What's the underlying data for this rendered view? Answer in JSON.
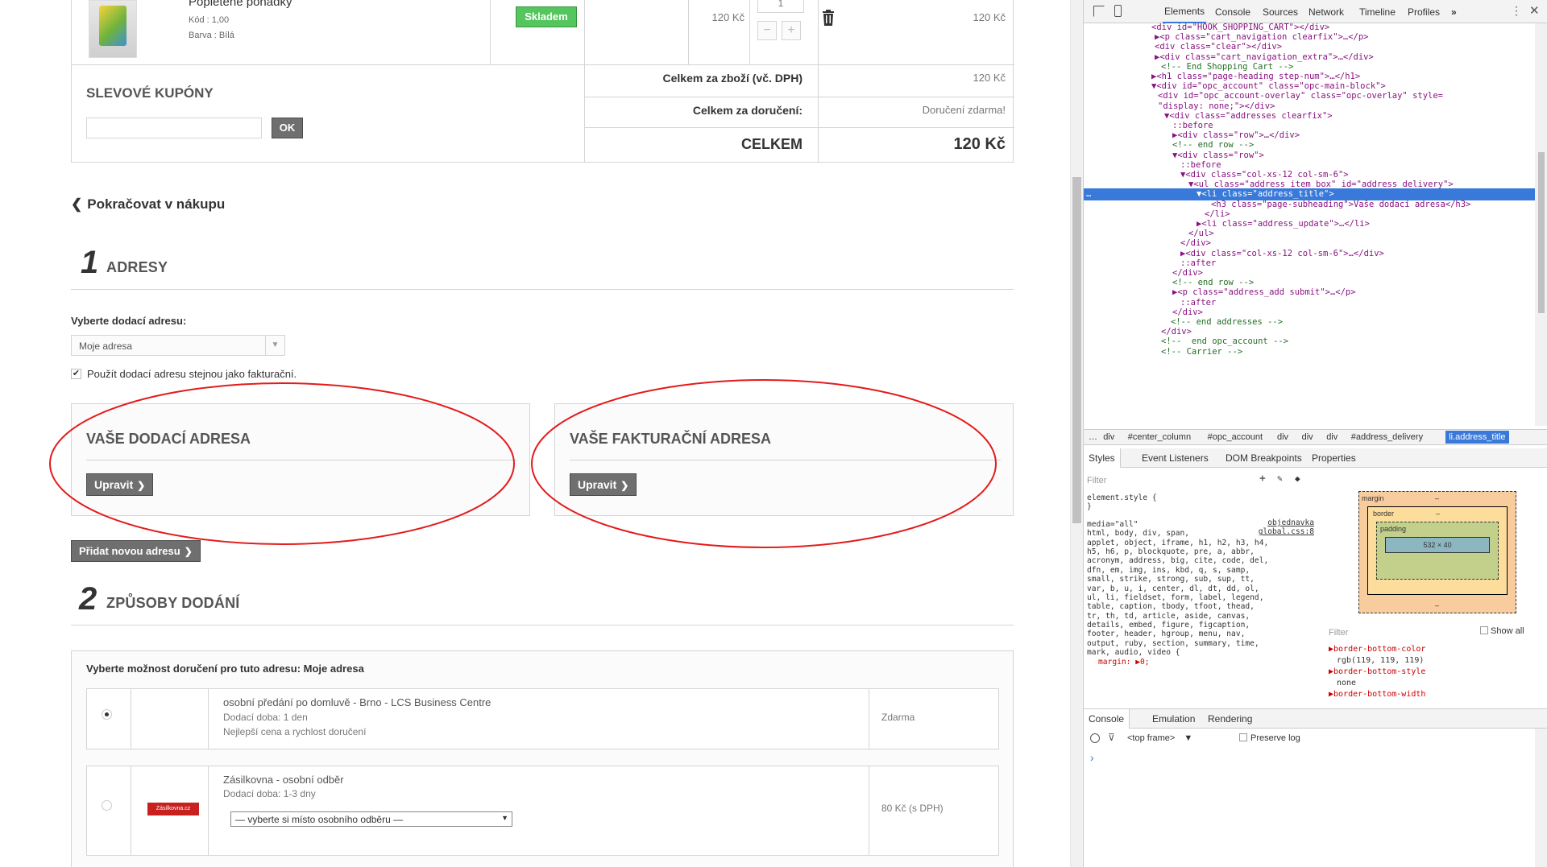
{
  "cart": {
    "product_name": "Popletené pohádky",
    "product_code": "Kód : 1,00",
    "product_color": "Barva : Bílá",
    "availability": "Skladem",
    "unit_price": "120 Kč",
    "quantity": "1",
    "line_total": "120 Kč",
    "minus": "−",
    "plus": "+"
  },
  "coupons": {
    "title": "SLEVOVÉ KUPÓNY",
    "input_value": "",
    "ok_label": "OK"
  },
  "summary": {
    "goods_label": "Celkem za zboží (vč. DPH)",
    "goods_value": "120 Kč",
    "delivery_label": "Celkem za doručení:",
    "delivery_value": "Doručení zdarma!",
    "total_label": "CELKEM",
    "total_value": "120 Kč"
  },
  "continue_shopping": "Pokračovat v nákupu",
  "step1": {
    "number": "1",
    "title": "ADRESY",
    "select_label": "Vyberte dodací adresu:",
    "select_value": "Moje adresa",
    "same_address_label": "Použít dodací adresu stejnou jako fakturační.",
    "same_address_checked": true,
    "delivery_title": "VAŠE DODACÍ ADRESA",
    "billing_title": "VAŠE FAKTURAČNÍ ADRESA",
    "edit_label": "Upravit",
    "add_new_label": "Přidat novou adresu"
  },
  "step2": {
    "number": "2",
    "title": "ZPŮSOBY DODÁNÍ",
    "choose_label": "Vyberte možnost doručení pro tuto adresu: Moje adresa",
    "options": [
      {
        "name": "osobní předání po domluvě - Brno - LCS Business Centre",
        "time": "Dodací doba: 1 den",
        "note": "Nejlepší cena a rychlost doručení",
        "price": "Zdarma",
        "selected": true
      },
      {
        "name": "Zásilkovna - osobní odběr",
        "time": "Dodací doba: 1-3 dny",
        "select_placeholder": "— vyberte si místo osobního odběru —",
        "logo_text": "Zásilkovna.cz",
        "price": "80 Kč (s DPH)",
        "selected": false
      }
    ]
  },
  "devtools": {
    "tabs": [
      "Elements",
      "Console",
      "Sources",
      "Network",
      "Timeline",
      "Profiles",
      "»"
    ],
    "dom_lines": [
      "<div id=\"HOOK_SHOPPING_CART\"></div>",
      "▶<p class=\"cart_navigation clearfix\">…</p>",
      "<div class=\"clear\"></div>",
      "▶<div class=\"cart_navigation_extra\">…</div>",
      "<!-- End Shopping Cart -->",
      "▶<h1 class=\"page-heading step-num\">…</h1>",
      "▼<div id=\"opc_account\" class=\"opc-main-block\">",
      "<div id=\"opc_account-overlay\" class=\"opc-overlay\" style=",
      "\"display: none;\"></div>",
      "▼<div class=\"addresses clearfix\">",
      "::before",
      "▶<div class=\"row\">…</div>",
      "<!-- end row -->",
      "▼<div class=\"row\">",
      "::before",
      "▼<div class=\"col-xs-12 col-sm-6\">",
      "▼<ul class=\"address item box\" id=\"address_delivery\">",
      "▼<li class=\"address_title\">",
      "<h3 class=\"page-subheading\">Vaše dodací adresa</h3>",
      "</li>",
      "▶<li class=\"address_update\">…</li>",
      "</ul>",
      "</div>",
      "▶<div class=\"col-xs-12 col-sm-6\">…</div>",
      "::after",
      "</div>",
      "<!-- end row -->",
      "▶<p class=\"address_add submit\">…</p>",
      "::after",
      "</div>",
      "<!-- end addresses -->",
      "</div>",
      "<!--  end opc_account -->",
      "<!-- Carrier -->"
    ],
    "breadcrumbs": [
      "…",
      "div",
      "#center_column",
      "#opc_account",
      "div",
      "div",
      "div",
      "#address_delivery",
      "li.address_title"
    ],
    "sub_tabs": [
      "Styles",
      "Event Listeners",
      "DOM Breakpoints",
      "Properties"
    ],
    "filter_placeholder": "Filter",
    "style_lines": [
      "element.style {",
      "}",
      "media=\"all\"",
      "html, body, div, span,",
      "applet, object, iframe, h1, h2, h3, h4,",
      "h5, h6, p, blockquote, pre, a, abbr,",
      "acronym, address, big, cite, code, del,",
      "dfn, em, img, ins, kbd, q, s, samp,",
      "small, strike, strong, sub, sup, tt,",
      "var, b, u, i, center, dl, dt, dd, ol,",
      "ul, li, fieldset, form, label, legend,",
      "table, caption, tbody, tfoot, thead,",
      "tr, th, td, article, aside, canvas,",
      "details, embed, figure, figcaption,",
      "footer, header, hgroup, menu, nav,",
      "output, ruby, section, summary, time,",
      "mark, audio, video {",
      "margin: ▶0;"
    ],
    "style_source": "objednavka",
    "style_source2": "global.css:8",
    "box_model": {
      "margin": "margin",
      "border": "border",
      "padding": "padding",
      "content": "532 × 40",
      "dash": "–"
    },
    "computed_filter": "Filter",
    "show_all": "Show all",
    "computed": [
      {
        "prop": "border-bottom-color",
        "value": "rgb(119, 119, 119)"
      },
      {
        "prop": "border-bottom-style",
        "value": "none"
      },
      {
        "prop": "border-bottom-width",
        "value": ""
      }
    ],
    "drawer_tabs": [
      "Console",
      "Emulation",
      "Rendering"
    ],
    "frame": "<top frame>",
    "preserve_log": "Preserve log",
    "prompt": "›"
  },
  "colors": {
    "accent_green": "#46a74e",
    "ellipse_red": "#e31b1b",
    "selection_blue": "#3879d9"
  }
}
